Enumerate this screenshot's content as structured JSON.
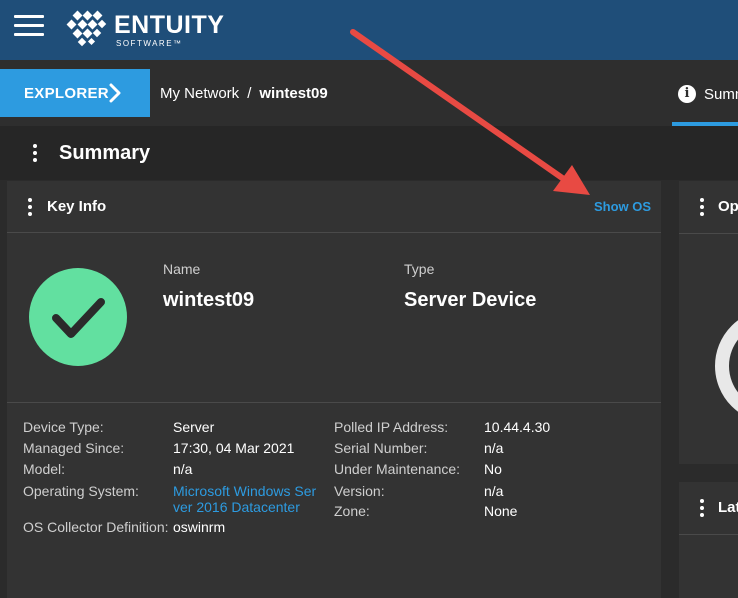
{
  "appbar": {
    "brand": "ENTUITY",
    "brand_sub": "SOFTWARE™"
  },
  "breadcrumb": {
    "explorer_label": "EXPLORER",
    "path_root": "My Network",
    "separator": "/",
    "current": "wintest09",
    "tab_label": "Summ"
  },
  "summary": {
    "title": "Summary"
  },
  "key_info": {
    "title": "Key Info",
    "show_os_label": "Show OS",
    "name_label": "Name",
    "name_value": "wintest09",
    "type_label": "Type",
    "type_value": "Server Device",
    "status_icon": "check-icon",
    "details_left": [
      {
        "label": "Device Type:",
        "value": "Server"
      },
      {
        "label": "Managed Since:",
        "value": "17:30, 04 Mar 2021"
      },
      {
        "label": "Model:",
        "value": "n/a"
      },
      {
        "label": "Operating System:",
        "value": "Microsoft Windows Server 2016 Datacenter"
      },
      {
        "label": "OS Collector Definition:",
        "value": "oswinrm"
      }
    ],
    "details_right": [
      {
        "label": "Polled IP Address:",
        "value": "10.44.4.30"
      },
      {
        "label": "Serial Number:",
        "value": "n/a"
      },
      {
        "label": "Under Maintenance:",
        "value": "No"
      },
      {
        "label": "Version:",
        "value": "n/a"
      },
      {
        "label": "Zone:",
        "value": "None"
      }
    ]
  },
  "side_panels": {
    "top_title": "Ope",
    "bottom_title": "Lat"
  },
  "colors": {
    "appbar": "#1f4e79",
    "accent": "#2d9be0",
    "status_ok": "#62e0a0",
    "annotation_arrow": "#e84a43"
  }
}
